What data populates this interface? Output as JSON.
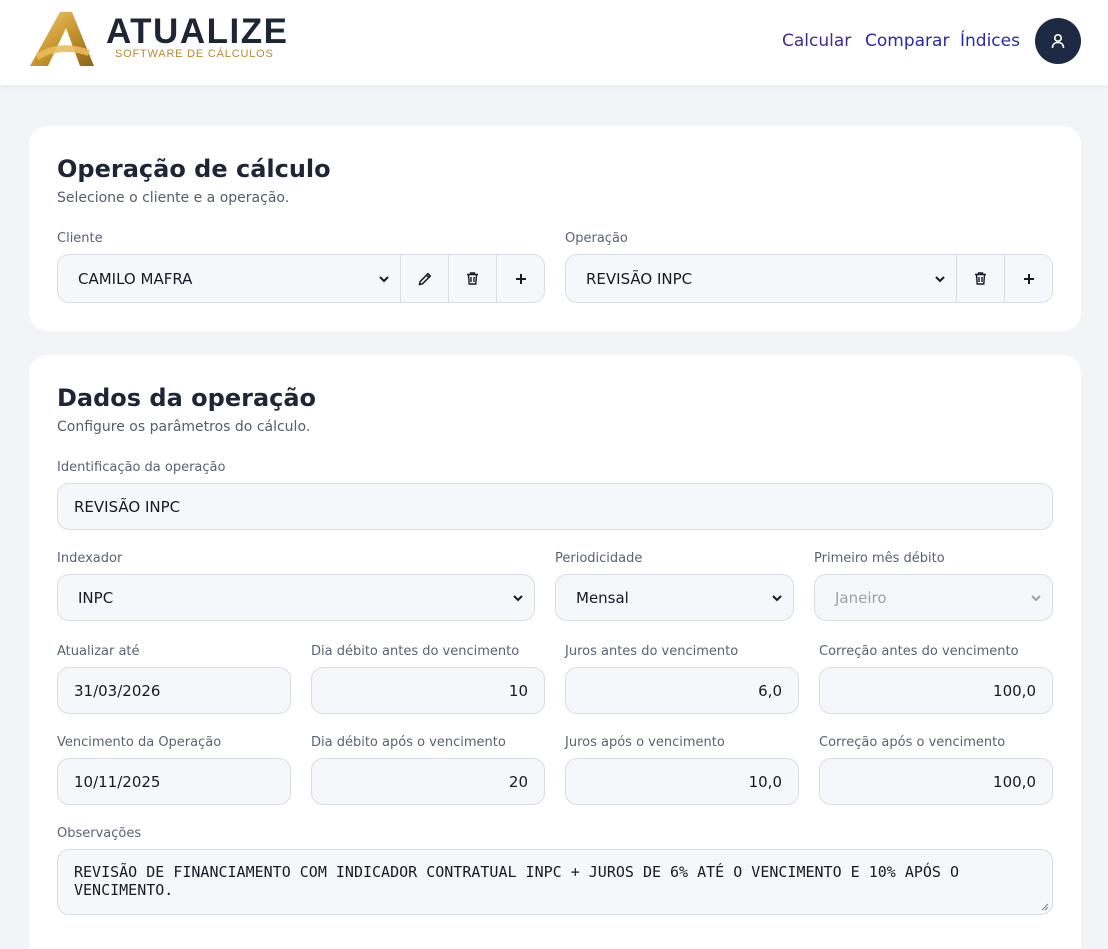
{
  "brand": {
    "name": "ATUALIZE",
    "tagline": "SOFTWARE DE CÁLCULOS"
  },
  "nav": {
    "calcular": "Calcular",
    "comparar": "Comparar",
    "indices": "Índices"
  },
  "calc_card": {
    "title": "Operação de cálculo",
    "subtitle": "Selecione o cliente e a operação.",
    "cliente_label": "Cliente",
    "cliente_value": "CAMILO MAFRA",
    "operacao_label": "Operação",
    "operacao_value": "REVISÃO INPC"
  },
  "data_card": {
    "title": "Dados da operação",
    "subtitle": "Configure os parâmetros do cálculo.",
    "identificacao_label": "Identificação da operação",
    "identificacao_value": "REVISÃO INPC",
    "indexador_label": "Indexador",
    "indexador_value": "INPC",
    "periodicidade_label": "Periodicidade",
    "periodicidade_value": "Mensal",
    "primeiro_mes_label": "Primeiro mês débito",
    "primeiro_mes_value": "Janeiro",
    "atualizar_ate_label": "Atualizar até",
    "atualizar_ate_value": "31/03/2026",
    "dia_debito_antes_label": "Dia débito antes do vencimento",
    "dia_debito_antes_value": "10",
    "juros_antes_label": "Juros antes do vencimento",
    "juros_antes_value": "6,0",
    "correcao_antes_label": "Correção antes do vencimento",
    "correcao_antes_value": "100,0",
    "vencimento_label": "Vencimento da Operação",
    "vencimento_value": "10/11/2025",
    "dia_debito_apos_label": "Dia débito após o vencimento",
    "dia_debito_apos_value": "20",
    "juros_apos_label": "Juros após o vencimento",
    "juros_apos_value": "10,0",
    "correcao_apos_label": "Correção após o vencimento",
    "correcao_apos_value": "100,0",
    "observacoes_label": "Observações",
    "observacoes_value": "REVISÃO DE FINANCIAMENTO COM INDICADOR CONTRATUAL INPC + JUROS DE 6% ATÉ O VENCIMENTO E 10% APÓS O VENCIMENTO."
  }
}
